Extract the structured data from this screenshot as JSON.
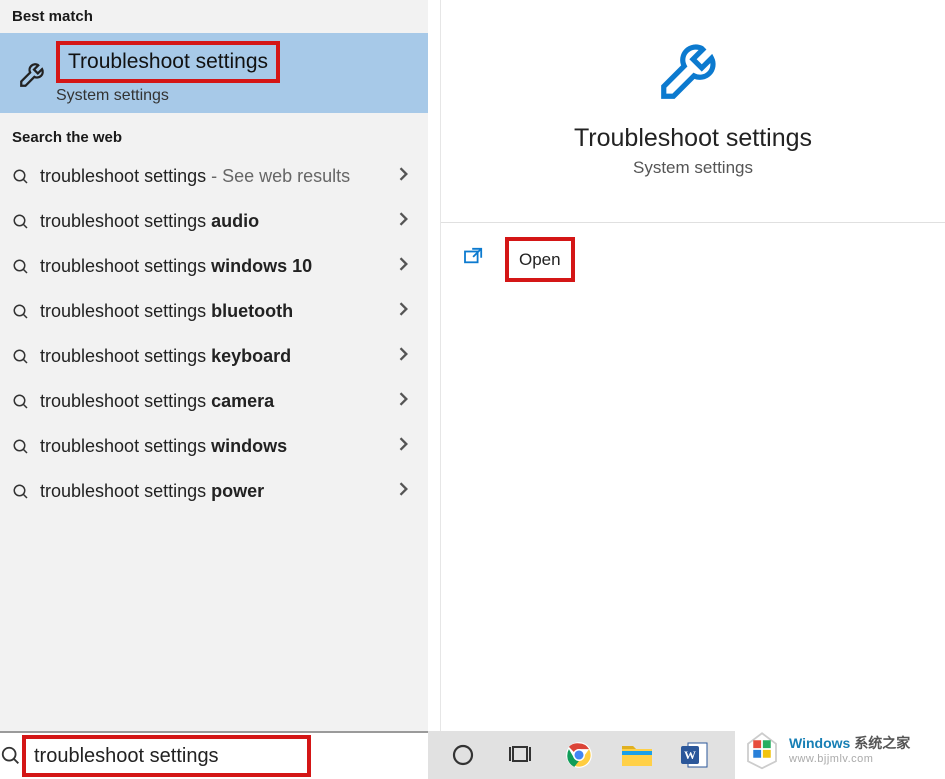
{
  "left": {
    "best_match_header": "Best match",
    "best_match": {
      "title": "Troubleshoot settings",
      "subtitle": "System settings"
    },
    "web_header": "Search the web",
    "web_plain": "troubleshoot settings",
    "web_hint": " - See web results",
    "suggestions": [
      {
        "prefix": "troubleshoot settings ",
        "bold": "audio"
      },
      {
        "prefix": "troubleshoot settings ",
        "bold": "windows 10"
      },
      {
        "prefix": "troubleshoot settings ",
        "bold": "bluetooth"
      },
      {
        "prefix": "troubleshoot settings ",
        "bold": "keyboard"
      },
      {
        "prefix": "troubleshoot settings ",
        "bold": "camera"
      },
      {
        "prefix": "troubleshoot settings ",
        "bold": "windows"
      },
      {
        "prefix": "troubleshoot settings ",
        "bold": "power"
      }
    ]
  },
  "right": {
    "title": "Troubleshoot settings",
    "subtitle": "System settings",
    "open_label": "Open"
  },
  "search": {
    "value": "troubleshoot settings"
  },
  "watermark": {
    "brand": "Windows",
    "brand_cn": " 系统之家",
    "url": "www.bjjmlv.com"
  },
  "colors": {
    "highlight_border": "#d41616",
    "selected_bg": "#a7c9e8",
    "accent_blue": "#0c7acf"
  }
}
